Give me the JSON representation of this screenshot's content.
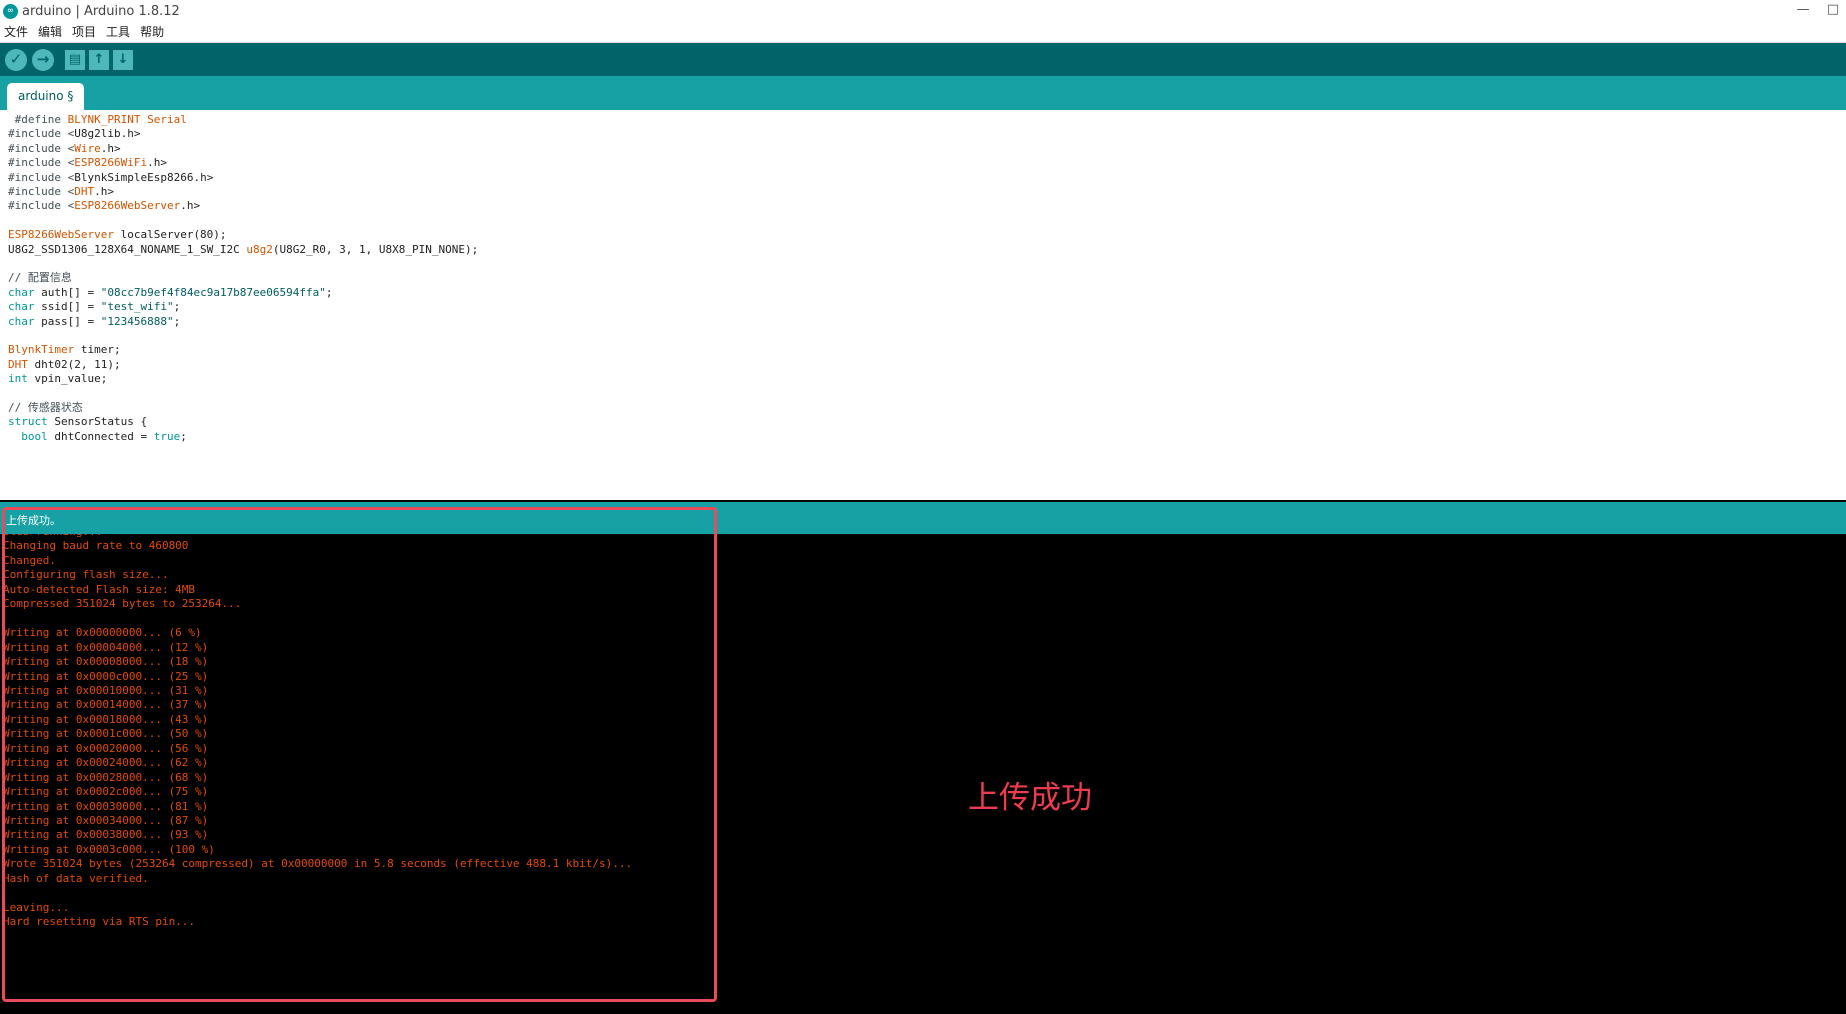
{
  "window": {
    "title": "arduino | Arduino 1.8.12",
    "minimize_label": "—",
    "maximize_label": "□"
  },
  "menu": [
    "文件",
    "编辑",
    "项目",
    "工具",
    "帮助"
  ],
  "toolbar": {
    "verify_icon": "checkmark-icon",
    "upload_icon": "arrow-right-icon",
    "new_icon": "new-file-icon",
    "open_icon": "arrow-up-icon",
    "save_icon": "arrow-down-icon"
  },
  "tab": {
    "label": "arduino §"
  },
  "code": [
    [
      {
        "t": " #define ",
        "c": "kw-gray"
      },
      {
        "t": "BLYNK_PRINT Serial",
        "c": "kw-orange"
      }
    ],
    [
      {
        "t": "#include <",
        "c": "kw-gray"
      },
      {
        "t": "U8g2lib.h",
        "c": ""
      },
      {
        "t": ">",
        "c": ""
      }
    ],
    [
      {
        "t": "#include <",
        "c": "kw-gray"
      },
      {
        "t": "Wire",
        "c": "kw-orange"
      },
      {
        "t": ".h>",
        "c": ""
      }
    ],
    [
      {
        "t": "#include <",
        "c": "kw-gray"
      },
      {
        "t": "ESP8266WiFi",
        "c": "kw-orange"
      },
      {
        "t": ".h>",
        "c": ""
      }
    ],
    [
      {
        "t": "#include <",
        "c": "kw-gray"
      },
      {
        "t": "BlynkSimpleEsp8266.h",
        "c": ""
      },
      {
        "t": ">",
        "c": ""
      }
    ],
    [
      {
        "t": "#include <",
        "c": "kw-gray"
      },
      {
        "t": "DHT",
        "c": "kw-orange"
      },
      {
        "t": ".h>",
        "c": ""
      }
    ],
    [
      {
        "t": "#include <",
        "c": "kw-gray"
      },
      {
        "t": "ESP8266WebServer",
        "c": "kw-orange"
      },
      {
        "t": ".h>",
        "c": ""
      }
    ],
    [],
    [
      {
        "t": "ESP8266WebServer",
        "c": "kw-orange"
      },
      {
        "t": " localServer(80);",
        "c": ""
      }
    ],
    [
      {
        "t": "U8G2_SSD1306_128X64_NONAME_1_SW_I2C ",
        "c": ""
      },
      {
        "t": "u8g2",
        "c": "kw-orange"
      },
      {
        "t": "(U8G2_R0, 3, 1, U8X8_PIN_NONE);",
        "c": ""
      }
    ],
    [],
    [
      {
        "t": "// 配置信息",
        "c": "cmt"
      }
    ],
    [
      {
        "t": "char",
        "c": "kw-teal"
      },
      {
        "t": " auth[] = ",
        "c": ""
      },
      {
        "t": "\"08cc7b9ef4f84ec9a17b87ee06594ffa\"",
        "c": "str"
      },
      {
        "t": ";",
        "c": ""
      }
    ],
    [
      {
        "t": "char",
        "c": "kw-teal"
      },
      {
        "t": " ssid[] = ",
        "c": ""
      },
      {
        "t": "\"test_wifi\"",
        "c": "str"
      },
      {
        "t": ";",
        "c": ""
      }
    ],
    [
      {
        "t": "char",
        "c": "kw-teal"
      },
      {
        "t": " pass[] = ",
        "c": ""
      },
      {
        "t": "\"123456888\"",
        "c": "str"
      },
      {
        "t": ";",
        "c": ""
      }
    ],
    [],
    [
      {
        "t": "BlynkTimer",
        "c": "kw-orange"
      },
      {
        "t": " timer;",
        "c": ""
      }
    ],
    [
      {
        "t": "DHT",
        "c": "kw-orange"
      },
      {
        "t": " dht02(2, 11);",
        "c": ""
      }
    ],
    [
      {
        "t": "int",
        "c": "kw-teal"
      },
      {
        "t": " vpin_value;",
        "c": ""
      }
    ],
    [],
    [
      {
        "t": "// 传感器状态",
        "c": "cmt"
      }
    ],
    [
      {
        "t": "struct",
        "c": "kw-teal"
      },
      {
        "t": " SensorStatus {",
        "c": ""
      }
    ],
    [
      {
        "t": "  bool",
        "c": "kw-teal"
      },
      {
        "t": " dhtConnected = ",
        "c": ""
      },
      {
        "t": "true",
        "c": "kw-teal"
      },
      {
        "t": ";",
        "c": ""
      }
    ]
  ],
  "status": {
    "message": "上传成功。"
  },
  "console": [
    "Stub running...",
    "Changing baud rate to 460800",
    "Changed.",
    "Configuring flash size...",
    "Auto-detected Flash size: 4MB",
    "Compressed 351024 bytes to 253264...",
    "",
    "Writing at 0x00000000... (6 %)",
    "Writing at 0x00004000... (12 %)",
    "Writing at 0x00008000... (18 %)",
    "Writing at 0x0000c000... (25 %)",
    "Writing at 0x00010000... (31 %)",
    "Writing at 0x00014000... (37 %)",
    "Writing at 0x00018000... (43 %)",
    "Writing at 0x0001c000... (50 %)",
    "Writing at 0x00020000... (56 %)",
    "Writing at 0x00024000... (62 %)",
    "Writing at 0x00028000... (68 %)",
    "Writing at 0x0002c000... (75 %)",
    "Writing at 0x00030000... (81 %)",
    "Writing at 0x00034000... (87 %)",
    "Writing at 0x00038000... (93 %)",
    "Writing at 0x0003c000... (100 %)",
    "Wrote 351024 bytes (253264 compressed) at 0x00000000 in 5.8 seconds (effective 488.1 kbit/s)...",
    "Hash of data verified.",
    "",
    "Leaving...",
    "Hard resetting via RTS pin..."
  ],
  "annotation": {
    "text": "上传成功"
  },
  "colors": {
    "toolbar_bg": "#006468",
    "tab_bg": "#17a1a5",
    "console_text": "#e34c00",
    "annotation": "#ee3b4e"
  }
}
